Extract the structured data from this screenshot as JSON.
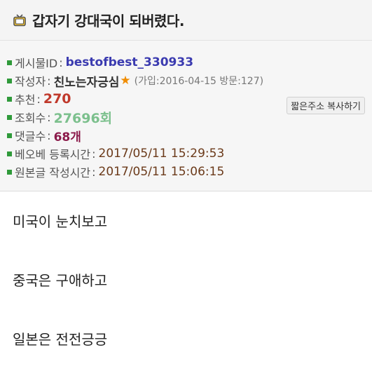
{
  "header": {
    "icon": "tv-icon",
    "title": "갑자기 강대국이 되버렸다."
  },
  "meta": {
    "post_id_label": "게시물ID",
    "post_id": "bestofbest_330933",
    "copy_button": "짧은주소 복사하기",
    "author_label": "작성자",
    "author": "친노는자긍심",
    "author_star": "★",
    "author_info": "(가입:2016-04-15 방문:127)",
    "recommend_label": "추천",
    "recommend": "270",
    "views_label": "조회수",
    "views": "27696회",
    "comments_label": "댓글수",
    "comments": "68개",
    "best_time_label": "베오베 등록시간",
    "best_time": "2017/05/11 15:29:53",
    "orig_time_label": "원본글 작성시간",
    "orig_time": "2017/05/11 15:06:15"
  },
  "content": {
    "lines": [
      "미국이 눈치보고",
      "중국은 구애하고",
      "일본은 전전긍긍"
    ]
  },
  "colors": {
    "bullet": "#2f9a3a",
    "post_id": "#3b3bb0",
    "recommend": "#c0392b",
    "views": "#7cc08d",
    "comments": "#8b1a4a",
    "date": "#6b3a1a",
    "star": "#f08c00"
  }
}
